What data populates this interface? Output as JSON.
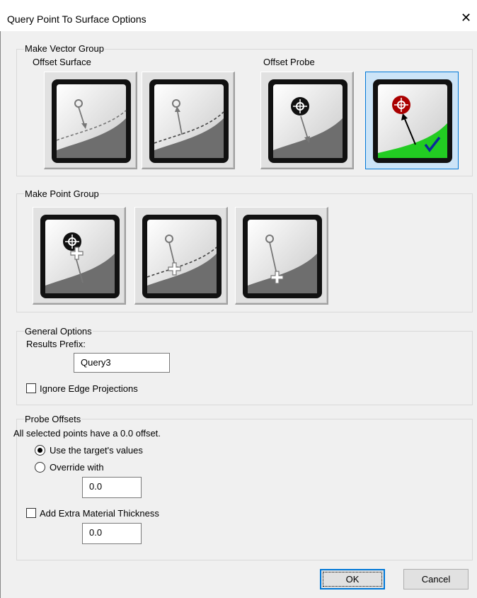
{
  "window": {
    "title": "Query Point To Surface Options",
    "close_glyph": "✕"
  },
  "vector_group": {
    "label": "Make Vector Group",
    "offset_surface_label": "Offset Surface",
    "offset_probe_label": "Offset Probe",
    "buttons": [
      {
        "icon": "offset-surface-down-icon",
        "selected": false
      },
      {
        "icon": "offset-surface-up-icon",
        "selected": false
      },
      {
        "icon": "offset-probe-down-icon",
        "selected": false
      },
      {
        "icon": "offset-probe-up-icon",
        "selected": true
      }
    ]
  },
  "point_group": {
    "label": "Make Point Group",
    "buttons": [
      {
        "icon": "point-at-probe-icon"
      },
      {
        "icon": "point-at-offset-surface-icon"
      },
      {
        "icon": "point-at-surface-icon"
      }
    ]
  },
  "general_options": {
    "label": "General Options",
    "results_prefix_label": "Results Prefix:",
    "results_prefix_value": "Query3",
    "ignore_edge_label": "Ignore Edge Projections",
    "ignore_edge_checked": false
  },
  "probe_offsets": {
    "label": "Probe Offsets",
    "info_text": "All selected points have a 0.0 offset.",
    "use_target_label": "Use the target's values",
    "override_label": "Override with",
    "selected_option": "use_target",
    "override_value": "0.0",
    "extra_thickness_label": "Add Extra Material Thickness",
    "extra_thickness_checked": false,
    "extra_thickness_value": "0.0"
  },
  "buttons": {
    "ok": "OK",
    "cancel": "Cancel"
  },
  "colors": {
    "selection_border": "#0078d7",
    "selection_fill": "#cce4f7",
    "surface_green": "#22cc22",
    "probe_red": "#cc0000"
  }
}
